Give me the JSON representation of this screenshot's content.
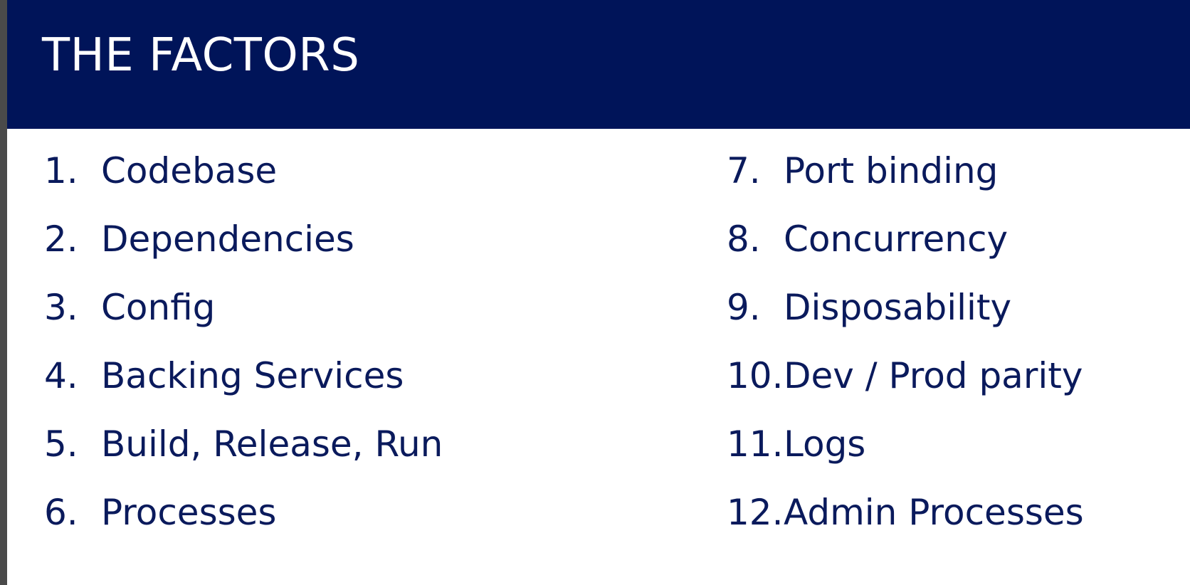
{
  "header": {
    "title": "THE FACTORS"
  },
  "factors": {
    "left": [
      {
        "num": "1.",
        "label": "Codebase"
      },
      {
        "num": "2.",
        "label": "Dependencies"
      },
      {
        "num": "3.",
        "label": "Config"
      },
      {
        "num": "4.",
        "label": "Backing Services"
      },
      {
        "num": "5.",
        "label": "Build, Release, Run"
      },
      {
        "num": "6.",
        "label": "Processes"
      }
    ],
    "right": [
      {
        "num": "7.",
        "label": "Port binding"
      },
      {
        "num": "8.",
        "label": "Concurrency"
      },
      {
        "num": "9.",
        "label": "Disposability"
      },
      {
        "num": "10.",
        "label": "Dev / Prod parity"
      },
      {
        "num": "11.",
        "label": "Logs"
      },
      {
        "num": "12.",
        "label": "Admin Processes"
      }
    ]
  },
  "colors": {
    "header_bg": "#001459",
    "title_text": "#ffffff",
    "body_text": "#0a1a5c",
    "left_edge": "#4a4a4a",
    "page_bg": "#ffffff"
  }
}
